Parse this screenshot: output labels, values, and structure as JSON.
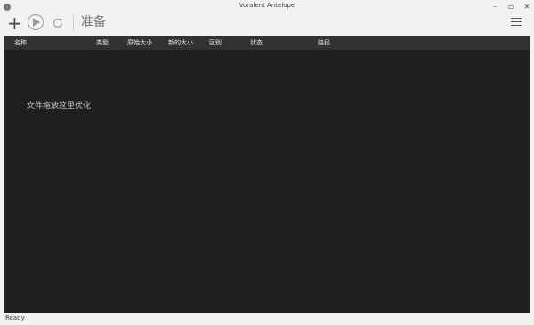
{
  "window": {
    "title": "Voralent Antelope",
    "minimize_glyph": "–",
    "maximize_glyph": "▭",
    "close_glyph": "✕"
  },
  "toolbar": {
    "add_glyph": "+",
    "status_label": "准备"
  },
  "table": {
    "columns": [
      "名称",
      "类型",
      "原始大小",
      "新的大小",
      "区别",
      "状态",
      "路径"
    ]
  },
  "content": {
    "drop_hint": "文件拖放这里优化"
  },
  "statusbar": {
    "text": "Ready"
  }
}
